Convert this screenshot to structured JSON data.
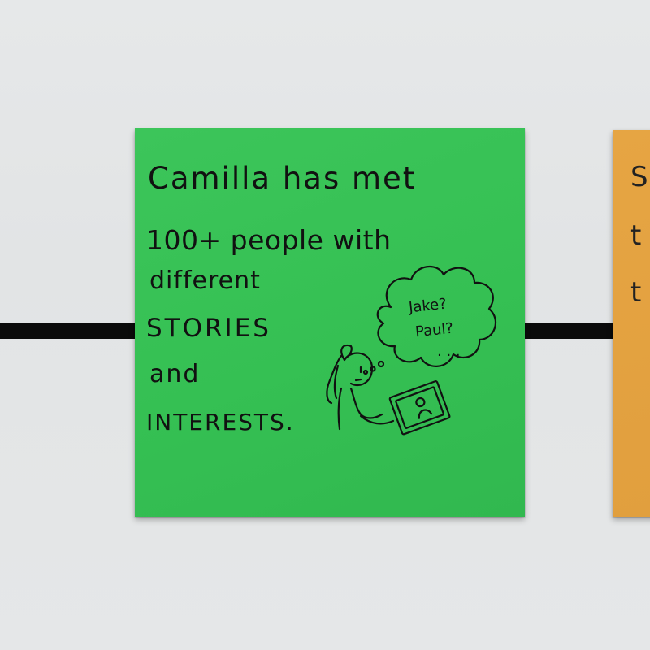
{
  "green_note": {
    "lines": [
      "Camilla has met",
      "100+ people with",
      "different",
      "STORIES",
      "and",
      "INTERESTS."
    ],
    "thought_bubble": [
      "Jake?",
      "Paul?",
      ". . ."
    ]
  },
  "orange_note": {
    "visible_letters": [
      "S",
      "t",
      "t"
    ]
  },
  "colors": {
    "wall": "#e4e6e7",
    "timeline": "#0b0b0b",
    "green_note": "#36c054",
    "orange_note": "#e2a13f",
    "ink": "#111111"
  },
  "icons": {
    "doodle": "girl-holding-photo-icon",
    "thought": "thought-bubble-icon"
  }
}
